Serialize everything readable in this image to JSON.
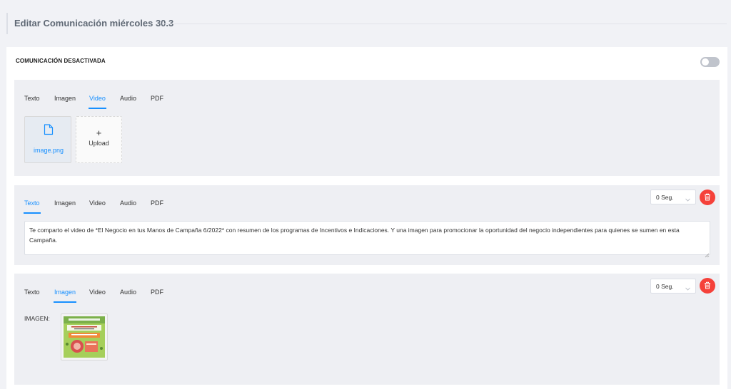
{
  "header": {
    "title": "Editar Comunicación miércoles 30.3"
  },
  "status_label": "COMUNICACIÓN DESACTIVADA",
  "toggle_on": false,
  "tab_labels": {
    "texto": "Texto",
    "imagen": "Imagen",
    "video": "Video",
    "audio": "Audio",
    "pdf": "PDF"
  },
  "blocks": [
    {
      "active_tab": "Video",
      "file_name": "image.png",
      "upload_label": "Upload",
      "upload_plus": "+"
    },
    {
      "active_tab": "Texto",
      "delay": "0 Seg.",
      "text": "Te comparto el video de *El Negocio en tus Manos de Campaña 6/2022* con resumen de los programas de Incentivos e Indicaciones. Y una imagen para promocionar la oportunidad del negocio independientes para quienes se sumen en esta Campaña."
    },
    {
      "active_tab": "Imagen",
      "delay": "0 Seg.",
      "image_label": "IMAGEN:"
    }
  ],
  "colors": {
    "accent": "#1890ff",
    "danger": "#f5413a",
    "panel": "#eeeff3",
    "page": "#f1f2f6"
  },
  "icons": {
    "file": "file-icon",
    "delete": "trash-icon",
    "chevron": "chevron-down-icon",
    "resize": "resize-handle-icon"
  }
}
